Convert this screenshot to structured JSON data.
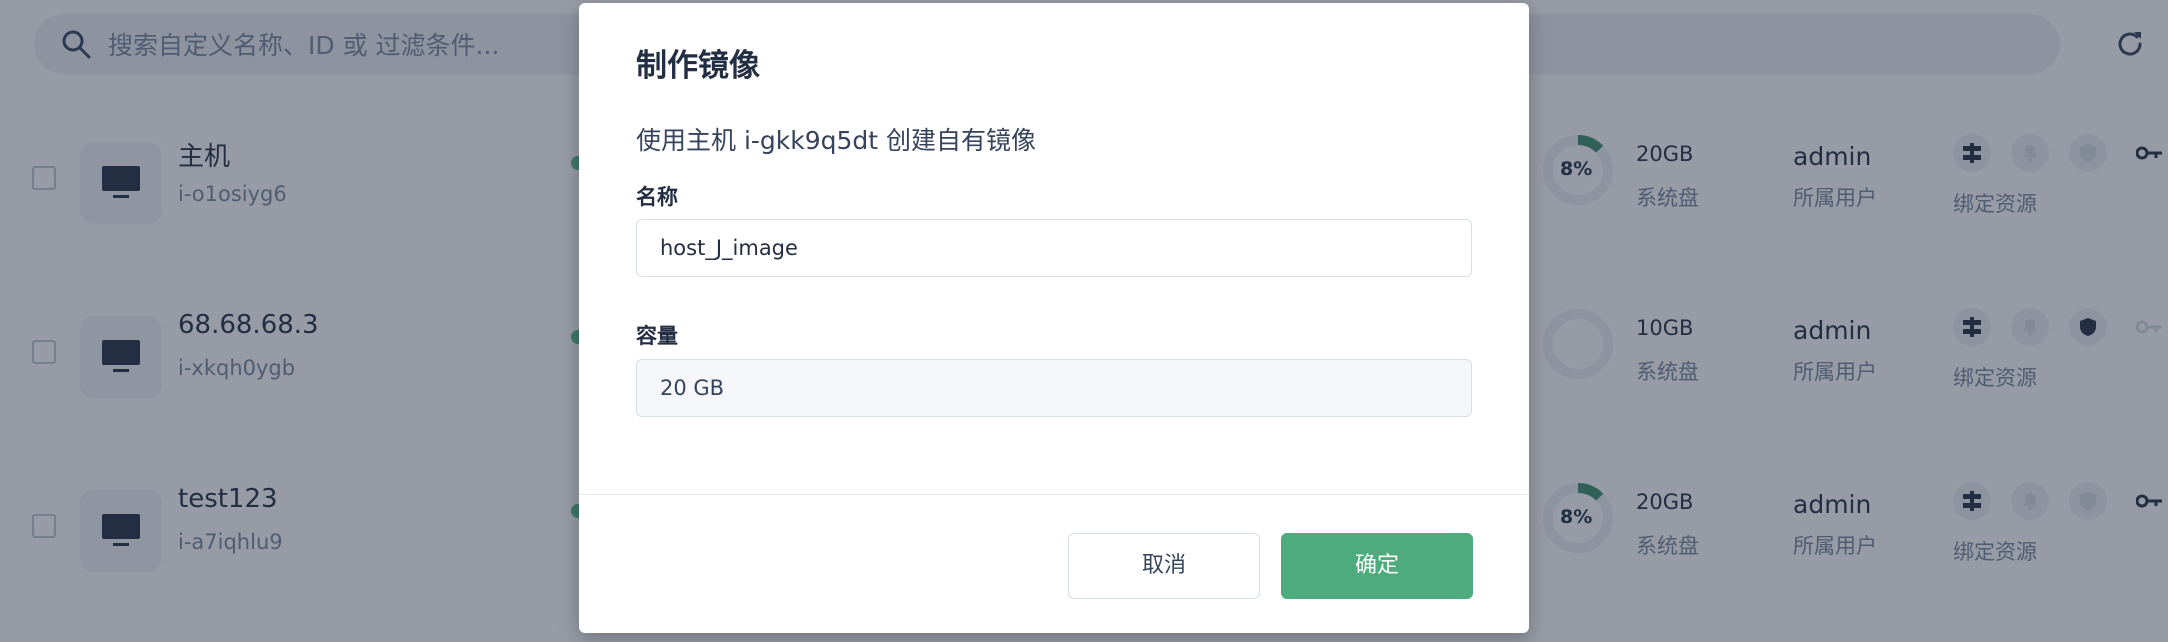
{
  "search": {
    "placeholder": "搜索自定义名称、ID 或 过滤条件..."
  },
  "hosts": [
    {
      "name": "主机",
      "id": "i-o1osiyg6",
      "usage": "8%",
      "usage_fraction": 0.08,
      "disk_size": "20GB",
      "disk_label": "系统盘",
      "owner": "admin",
      "owner_label": "所属用户",
      "resources_label": "绑定资源",
      "security_active": false,
      "key_active": true
    },
    {
      "name": "68.68.68.3",
      "id": "i-xkqh0ygb",
      "usage": "",
      "usage_fraction": 0,
      "disk_size": "10GB",
      "disk_label": "系统盘",
      "owner": "admin",
      "owner_label": "所属用户",
      "resources_label": "绑定资源",
      "security_active": true,
      "key_active": false
    },
    {
      "name": "test123",
      "id": "i-a7iqhlu9",
      "usage": "8%",
      "usage_fraction": 0.08,
      "disk_size": "20GB",
      "disk_label": "系统盘",
      "owner": "admin",
      "owner_label": "所属用户",
      "resources_label": "绑定资源",
      "security_active": false,
      "key_active": true
    }
  ],
  "modal": {
    "title": "制作镜像",
    "description": "使用主机 i-gkk9q5dt 创建自有镜像",
    "name_label": "名称",
    "name_value": "host_J_image",
    "capacity_label": "容量",
    "capacity_value": "20 GB",
    "cancel_label": "取消",
    "confirm_label": "确定"
  },
  "colors": {
    "accent": "#4dab7d",
    "status_running": "#55bc8a",
    "overlay": "#242e42"
  }
}
